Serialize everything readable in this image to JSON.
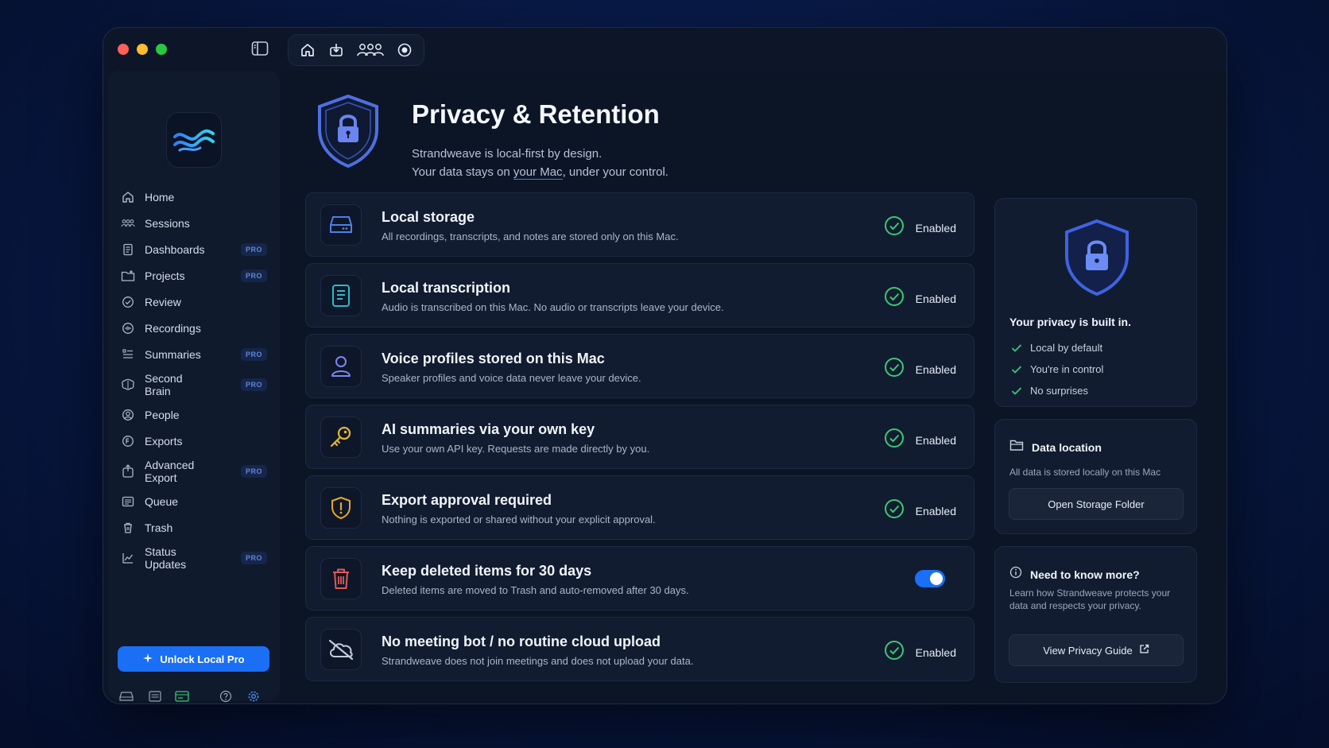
{
  "sidebar": {
    "items": [
      {
        "label": "Home",
        "icon": "home-icon",
        "pro": false
      },
      {
        "label": "Sessions",
        "icon": "people-group-icon",
        "pro": false
      },
      {
        "label": "Dashboards",
        "icon": "dashboard-icon",
        "pro": true
      },
      {
        "label": "Projects",
        "icon": "folder-icon",
        "pro": true
      },
      {
        "label": "Review",
        "icon": "check-circle-icon",
        "pro": false
      },
      {
        "label": "Recordings",
        "icon": "recording-icon",
        "pro": false
      },
      {
        "label": "Summaries",
        "icon": "list-icon",
        "pro": false,
        "badge_pro": true
      },
      {
        "label": "Second\nBrain",
        "icon": "brain-icon",
        "pro": true
      },
      {
        "label": "People",
        "icon": "person-circle-icon",
        "pro": false
      },
      {
        "label": "Exports",
        "icon": "export-icon",
        "pro": false
      },
      {
        "label": "Advanced\nExport",
        "icon": "advanced-export-icon",
        "pro": true
      },
      {
        "label": "Queue",
        "icon": "queue-icon",
        "pro": false
      },
      {
        "label": "Trash",
        "icon": "trash-icon",
        "pro": false
      },
      {
        "label": "Status\nUpdates",
        "icon": "chart-icon",
        "pro": true
      }
    ],
    "pro_badge": "PRO",
    "unlock_label": "Unlock Local Pro"
  },
  "header": {
    "title": "Privacy & Retention",
    "subtitle_line1": "Strandweave is local-first by design.",
    "subtitle_line2_a": "Your data stays on ",
    "subtitle_line2_link": "your Mac",
    "subtitle_line2_b": ", under your control."
  },
  "features": [
    {
      "title": "Local storage",
      "desc": "All recordings, transcripts, and notes are stored only on this Mac.",
      "status": "Enabled",
      "icon": "drive-icon",
      "color": "#4f7fe8"
    },
    {
      "title": "Local transcription",
      "desc": "Audio is transcribed on this Mac. No audio or transcripts leave your device.",
      "status": "Enabled",
      "icon": "document-icon",
      "color": "#2fb8c9"
    },
    {
      "title": "Voice profiles stored on this Mac",
      "desc": "Speaker profiles and voice data never leave your device.",
      "status": "Enabled",
      "icon": "user-icon",
      "color": "#7b86f0"
    },
    {
      "title": "AI summaries via your own key",
      "desc": "Use your own API key. Requests are made directly by you.",
      "status": "Enabled",
      "icon": "key-icon",
      "color": "#e6b530"
    },
    {
      "title": "Export approval required",
      "desc": "Nothing is exported or shared without your explicit approval.",
      "status": "Enabled",
      "icon": "shield-alert-icon",
      "color": "#e8a628"
    },
    {
      "title": "Keep deleted items for 30 days",
      "desc": "Deleted items are moved to Trash and auto-removed after 30 days.",
      "status": "",
      "toggle_on": true,
      "icon": "trash-icon",
      "color": "#e05a55"
    },
    {
      "title": "No meeting bot / no routine cloud upload",
      "desc": "Strandweave does not join meetings and does not upload your data.",
      "status": "Enabled",
      "icon": "cloud-off-icon",
      "color": "#c4ccd9"
    }
  ],
  "right": {
    "privacy_heading": "Your privacy is built in.",
    "checks": [
      "Local by default",
      "You're in control",
      "No surprises"
    ],
    "data_location_title": "Data location",
    "data_location_text": "All data is stored locally on this Mac",
    "open_folder_label": "Open Storage Folder",
    "more_title": "Need to know more?",
    "more_text": "Learn how Strandweave protects your data and respects your privacy.",
    "guide_label": "View Privacy Guide"
  },
  "colors": {
    "accent": "#1a6ff5",
    "success": "#3cc873",
    "shield": "#4f6fe0"
  }
}
